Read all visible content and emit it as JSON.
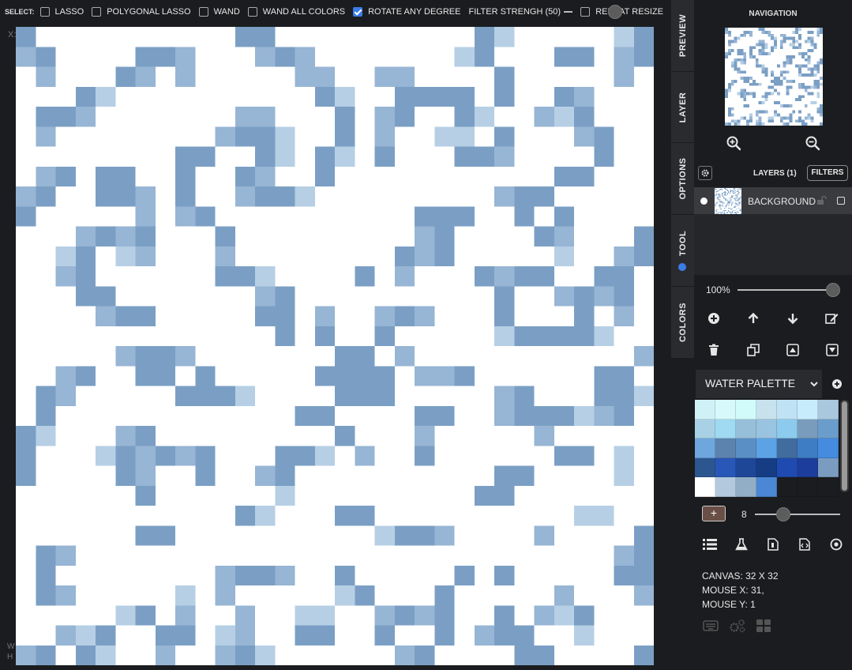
{
  "toolbar": {
    "select_label": "SELECT:",
    "options": [
      {
        "label": "LASSO",
        "checked": false
      },
      {
        "label": "POLYGONAL LASSO",
        "checked": false
      },
      {
        "label": "WAND",
        "checked": false
      },
      {
        "label": "WAND ALL COLORS",
        "checked": false
      },
      {
        "label": "ROTATE ANY DEGREE",
        "checked": true
      }
    ],
    "filter_label": "FILTER STRENGH (50)",
    "filter_value": 50,
    "repeat_label": "REPEAT RESIZE",
    "repeat_checked": false
  },
  "gutter": {
    "top": "X:",
    "bottom1": "W",
    "bottom2": "H"
  },
  "tabs": [
    {
      "label": "PREVIEW"
    },
    {
      "label": "LAYER"
    },
    {
      "label": "OPTIONS"
    },
    {
      "label": "TOOL"
    },
    {
      "label": "COLORS"
    }
  ],
  "navigation": {
    "title": "NAVIGATION"
  },
  "layers": {
    "title": "LAYERS (1)",
    "filters_label": "FILTERS",
    "items": [
      {
        "name": "BACKGROUND"
      }
    ]
  },
  "opacity": {
    "label": "100%"
  },
  "palette": {
    "name": "WATER PALETTE",
    "colors": [
      "#cff2f7",
      "#d6f9fb",
      "#d1fbfb",
      "#c7e2ed",
      "#bfe2f5",
      "#c7ecfb",
      "#a9c8de",
      "#a8d1e6",
      "#9fd9f2",
      "#98bfd9",
      "#99c3e0",
      "#8ccbee",
      "#7a9cbc",
      "#6a9dcb",
      "#6ea6de",
      "#5c82ae",
      "#5a8fc6",
      "#5ca3e6",
      "#416c9e",
      "#3e7dc4",
      "#458be0",
      "#2c5690",
      "#2857b8",
      "#1e4798",
      "#163c84",
      "#1f4bb0",
      "#1c3d9b",
      "#7a9cc0",
      "#ffffff",
      "#b3c9dd",
      "#92adc6",
      "#4a88d5",
      "#1b1c1f",
      "#1b1c1f",
      "#1b1c1f"
    ]
  },
  "brush": {
    "value": "8"
  },
  "canvas_info": {
    "size": "CANVAS: 32 X 32",
    "mouse_x": "MOUSE X: 31,",
    "mouse_y": "MOUSE Y: 1"
  },
  "canvas": {
    "colors": {
      "B": "#7b9fc4",
      "M": "#97b5d4",
      "L": "#b6cfe5"
    },
    "rows": [
      "B..........BB..........BL.....LB",
      "MB....BBM...MBM.......LB...BB.MB",
      ".M...BM.M.....MM..MM....B.....M.",
      "...BL..........BL..BBBB.B..BM...",
      ".BBM.......MM...B.MB..BL..MLB...",
      ".M........MBBL..B.M..LL.B...MB..",
      "........BB..BL.BL.B...BBM....B..",
      ".MB.BB..B..BM..B...........BB...",
      "MB..BBM.B..MBBL.........MBB.....",
      "B.....M.MB..........BBB..B.B....",
      "...MBMB...B.........MB....BM...B",
      "..LB.LM...M........BMB.....L..MB",
      "..MB......BBL....B.M...BMBB..BB.",
      "...BB.......MB..........B..MBMB.",
      "....MBB.....BB.M..MBM...B...B.M.",
      ".............B.B..B.....LBBBBL..",
      ".....MBBM.......BB.M...........M",
      "..MB..BB.B.....BBBB.MMB......BB.",
      ".BM.....BBBL....BBB.....MB...BBL",
      ".B............BB....BB..MBBBLMB.",
      "BL...MB.........B...M.....M.....",
      "B...LBMBMB...BBL.M..B......BB.L.",
      "B....BM..B..MB..........BB....L.",
      "......B......L.........BB.......",
      "...........BL...BB..........LL..",
      "......BB..........LBBM....M....B",
      ".BM...........................MB",
      ".B........MBBM..B.....B.B.....BB",
      ".BM.....L.M.....LB...B.....M...M",
      ".....LB.M..M..LL..MBMB..B.MLB...",
      "..MLB..BB.LM..BB..B..B.MBB..L...",
      "MB.BL..M..MBL......MB....BB....B"
    ]
  }
}
